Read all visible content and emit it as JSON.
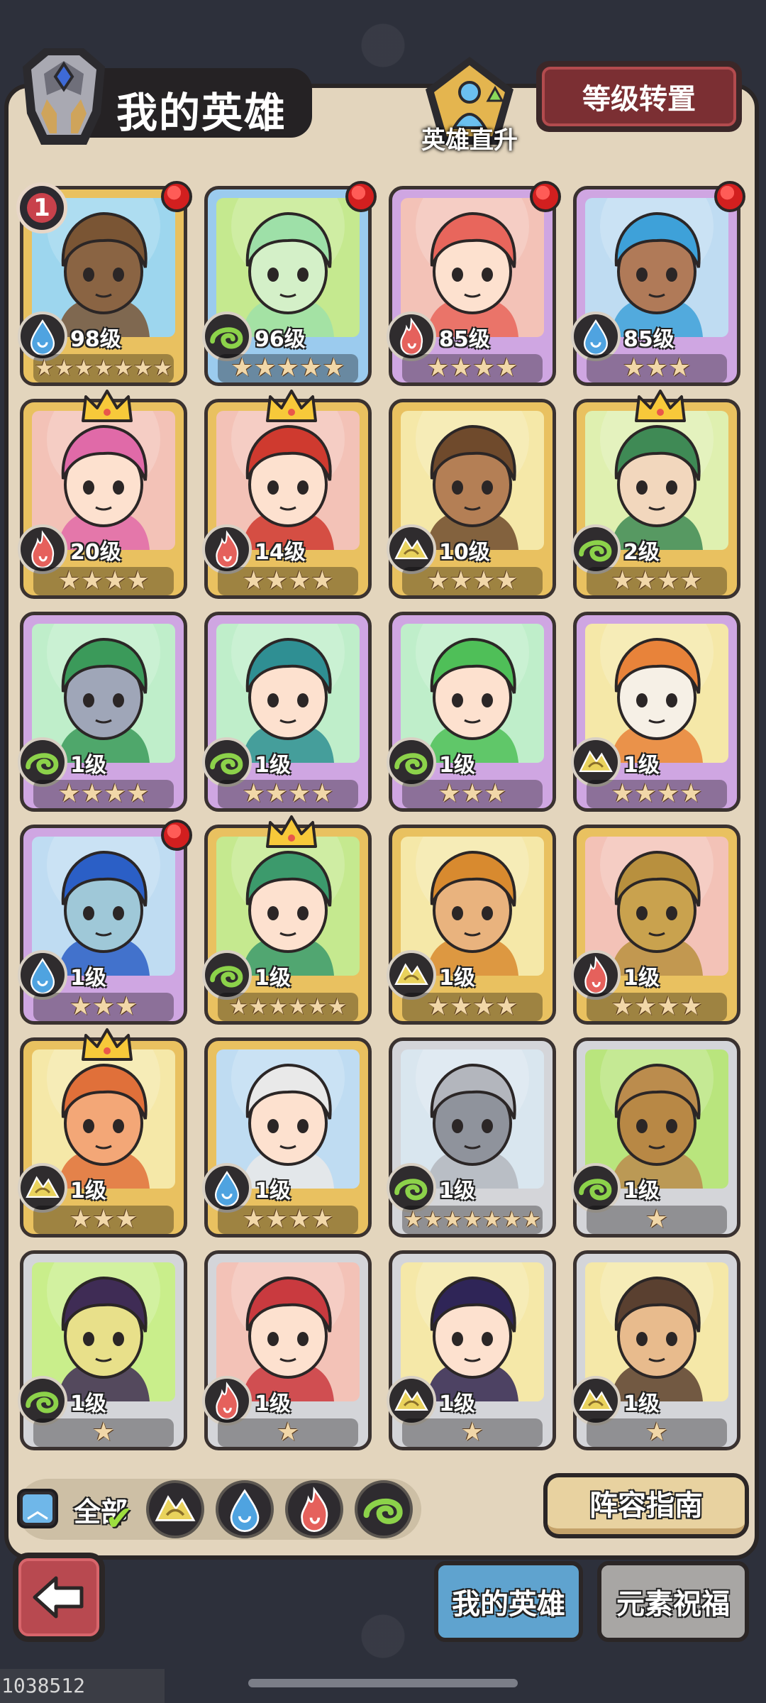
{
  "header": {
    "title": "我的英雄",
    "direct_up_label": "英雄直升",
    "transfer_button": "等级转置"
  },
  "heroes": [
    {
      "level": "98级",
      "element": "water",
      "stars": 7,
      "bg": "#9dd6ee",
      "frame": "#e9c160",
      "hair": "#7a5534",
      "skin": "#8a6443",
      "red_dot": true,
      "badge": "1"
    },
    {
      "level": "96级",
      "element": "wind",
      "stars": 5,
      "bg": "#c5e98f",
      "frame": "#9bcbee",
      "hair": "#9ee0a8",
      "skin": "#d4f0c8",
      "red_dot": true
    },
    {
      "level": "85级",
      "element": "fire",
      "stars": 4,
      "bg": "#f3c2b7",
      "frame": "#cfa6e2",
      "hair": "#e8665c",
      "skin": "#fde1cf",
      "red_dot": true
    },
    {
      "level": "85级",
      "element": "water",
      "stars": 3,
      "bg": "#bfdcf2",
      "frame": "#cfa6e2",
      "hair": "#3ea1d9",
      "skin": "#b07a58",
      "red_dot": true
    },
    {
      "level": "20级",
      "element": "fire",
      "stars": 4,
      "bg": "#f3c2b7",
      "frame": "#e9c160",
      "hair": "#e06aa8",
      "skin": "#fde1cf",
      "crown": true
    },
    {
      "level": "14级",
      "element": "fire",
      "stars": 4,
      "bg": "#f3c2b7",
      "frame": "#e9c160",
      "hair": "#cf3a2f",
      "skin": "#fde1cf",
      "crown": true
    },
    {
      "level": "10级",
      "element": "earth",
      "stars": 4,
      "bg": "#f5e8a8",
      "frame": "#e9c160",
      "hair": "#6f4a2c",
      "skin": "#b47f55"
    },
    {
      "level": "2级",
      "element": "wind",
      "stars": 4,
      "bg": "#dff0b0",
      "frame": "#e9c160",
      "hair": "#3f8a55",
      "skin": "#f2d7bd",
      "crown": true
    },
    {
      "level": "1级",
      "element": "wind",
      "stars": 4,
      "bg": "#bfeeca",
      "frame": "#cfa6e2",
      "hair": "#3b9a5a",
      "skin": "#9fa6b8"
    },
    {
      "level": "1级",
      "element": "wind",
      "stars": 4,
      "bg": "#bfeeca",
      "frame": "#cfa6e2",
      "hair": "#2f8f93",
      "skin": "#fde1cf"
    },
    {
      "level": "1级",
      "element": "wind",
      "stars": 3,
      "bg": "#bfeeca",
      "frame": "#cfa6e2",
      "hair": "#4fbf58",
      "skin": "#fde1cf"
    },
    {
      "level": "1级",
      "element": "earth",
      "stars": 4,
      "bg": "#f5e8a8",
      "frame": "#cfa6e2",
      "hair": "#e8833a",
      "skin": "#f6f0e6"
    },
    {
      "level": "1级",
      "element": "water",
      "stars": 3,
      "bg": "#bfdcf2",
      "frame": "#cfa6e2",
      "hair": "#2b5fc6",
      "skin": "#9fc8d8",
      "red_dot": true
    },
    {
      "level": "1级",
      "element": "wind",
      "stars": 6,
      "bg": "#c5e98f",
      "frame": "#e9c160",
      "hair": "#3c9a6c",
      "skin": "#fde1cf",
      "crown": true
    },
    {
      "level": "1级",
      "element": "earth",
      "stars": 4,
      "bg": "#f5e8a8",
      "frame": "#e9c160",
      "hair": "#d88a2f",
      "skin": "#e9b37e"
    },
    {
      "level": "1级",
      "element": "fire",
      "stars": 4,
      "bg": "#f3c2b7",
      "frame": "#e9c160",
      "hair": "#b8903e",
      "skin": "#c9a24e"
    },
    {
      "level": "1级",
      "element": "earth",
      "stars": 3,
      "bg": "#f5e8a8",
      "frame": "#e9c160",
      "hair": "#e0703a",
      "skin": "#f3a777",
      "crown": true
    },
    {
      "level": "1级",
      "element": "water",
      "stars": 4,
      "bg": "#bfdcf2",
      "frame": "#e9c160",
      "hair": "#e9e9e9",
      "skin": "#fde1cf"
    },
    {
      "level": "1级",
      "element": "wind",
      "stars": 7,
      "bg": "#d9e6ef",
      "frame": "#d4d5d9",
      "hair": "#b3b6bd",
      "skin": "#8f939c"
    },
    {
      "level": "1级",
      "element": "wind",
      "stars": 1,
      "bg": "#b9e57d",
      "frame": "#d4d5d9",
      "hair": "#bb8c4d",
      "skin": "#b88845"
    },
    {
      "level": "1级",
      "element": "wind",
      "stars": 1,
      "bg": "#c9ee8b",
      "frame": "#d4d5d9",
      "hair": "#3f2c55",
      "skin": "#e8e08a"
    },
    {
      "level": "1级",
      "element": "fire",
      "stars": 1,
      "bg": "#f3c2b7",
      "frame": "#d4d5d9",
      "hair": "#c93a3f",
      "skin": "#fde1cf"
    },
    {
      "level": "1级",
      "element": "earth",
      "stars": 1,
      "bg": "#f5e8a8",
      "frame": "#d4d5d9",
      "hair": "#2f2557",
      "skin": "#fde1cf"
    },
    {
      "level": "1级",
      "element": "earth",
      "stars": 1,
      "bg": "#f5e8a8",
      "frame": "#d4d5d9",
      "hair": "#5a4030",
      "skin": "#e8bb8d"
    }
  ],
  "filter": {
    "all_label": "全部",
    "elements": [
      "earth",
      "water",
      "fire",
      "wind"
    ]
  },
  "guide_button": "阵容指南",
  "tabs": {
    "my_heroes": "我的英雄",
    "element_blessing": "元素祝福"
  },
  "footer_id": "1038512 c0dd40",
  "colors": {
    "water": "#4fa3e0",
    "wind": "#8cd24a",
    "fire": "#e5615c",
    "earth": "#e9d25c"
  }
}
